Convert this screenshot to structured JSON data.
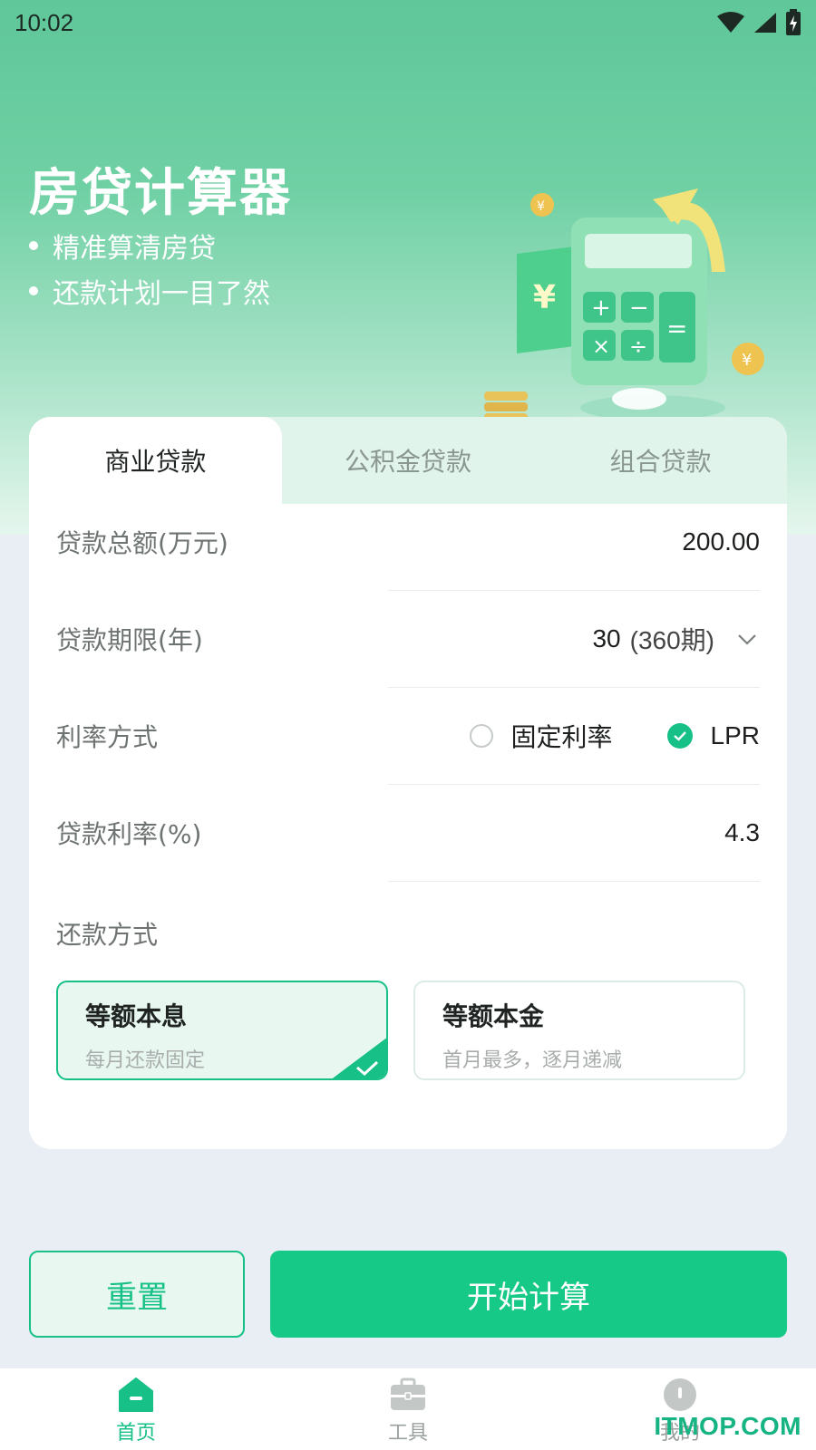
{
  "status_bar": {
    "time": "10:02"
  },
  "hero": {
    "title": "房贷计算器",
    "bullets": [
      "精准算清房贷",
      "还款计划一目了然"
    ]
  },
  "tabs": [
    {
      "label": "商业贷款",
      "active": true
    },
    {
      "label": "公积金贷款",
      "active": false
    },
    {
      "label": "组合贷款",
      "active": false
    }
  ],
  "form": {
    "amount": {
      "label": "贷款总额(万元)",
      "value": "200.00"
    },
    "term": {
      "label": "贷款期限(年)",
      "value": "30",
      "periods": "(360期)"
    },
    "rate_mode": {
      "label": "利率方式",
      "options": [
        {
          "label": "固定利率",
          "selected": false
        },
        {
          "label": "LPR",
          "selected": true
        }
      ]
    },
    "rate": {
      "label": "贷款利率(%)",
      "value": "4.3"
    },
    "repayment": {
      "label": "还款方式",
      "options": [
        {
          "title": "等额本息",
          "desc": "每月还款固定",
          "selected": true
        },
        {
          "title": "等额本金",
          "desc": "首月最多，逐月递减",
          "selected": false
        }
      ]
    }
  },
  "buttons": {
    "reset": "重置",
    "calculate": "开始计算"
  },
  "bottom_nav": [
    {
      "label": "首页",
      "icon": "home-icon",
      "active": true
    },
    {
      "label": "工具",
      "icon": "toolbox-icon",
      "active": false
    },
    {
      "label": "我的",
      "icon": "profile-icon",
      "active": false
    }
  ],
  "watermark": "ITMOP.COM",
  "colors": {
    "accent": "#16c086",
    "hero": "#5fc79a"
  }
}
